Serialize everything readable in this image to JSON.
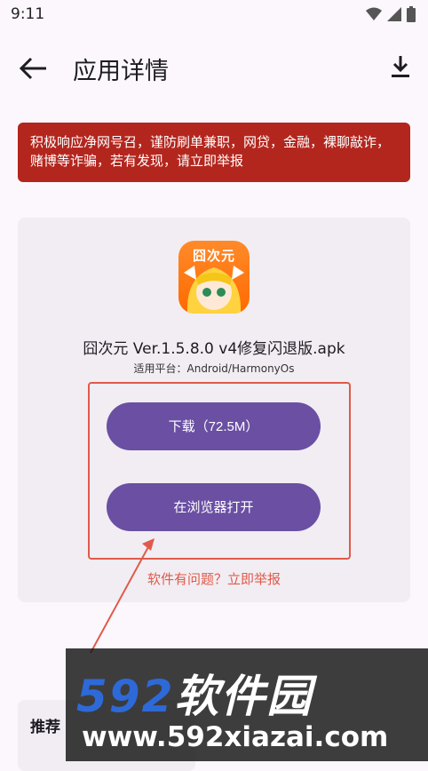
{
  "status_bar": {
    "time": "9:11"
  },
  "app_bar": {
    "title": "应用详情"
  },
  "warning": {
    "text": "积极响应净网号召，谨防刷单兼职，网贷，金融，裸聊敲诈，赌博等诈骗，若有发现，请立即举报"
  },
  "app": {
    "icon_text": "囧次元",
    "name": "囧次元 Ver.1.5.8.0  v4修复闪退版.apk",
    "platform": "适用平台：Android/HarmonyOs"
  },
  "buttons": {
    "download": "下载（72.5M）",
    "browser": "在浏览器打开"
  },
  "report_link": "软件有问题？立即举报",
  "recommend": {
    "title": "推荐"
  },
  "watermark": {
    "brand_num": "592",
    "brand_cn": "软件园",
    "url": "www.592xiazai.com"
  },
  "colors": {
    "primary": "#6a4fa3",
    "warning": "#b3261e",
    "annotation": "#e05a4a"
  }
}
